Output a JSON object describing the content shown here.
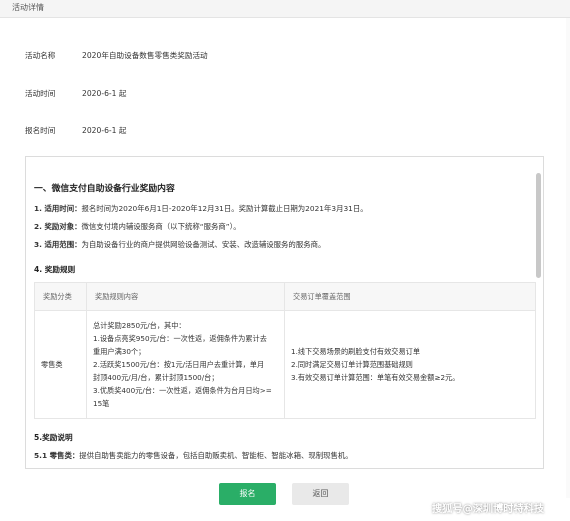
{
  "header": {
    "title": "活动详情"
  },
  "info": [
    {
      "label": "活动名称",
      "value": "2020年自助设备数售零售类奖励活动"
    },
    {
      "label": "活动时间",
      "value": "2020-6-1 起"
    },
    {
      "label": "报名时间",
      "value": "2020-6-1 起"
    }
  ],
  "panel": {
    "section_title": "一、微信支付自助设备行业奖励内容",
    "items": [
      {
        "key": "1. 适用时间：",
        "text": "报名时间为2020年6月1日-2020年12月31日。奖励计算截止日期为2021年3月31日。"
      },
      {
        "key": "2. 奖励对象：",
        "text": "微信支付境内辅设服务商（以下统称“服务商”）。"
      },
      {
        "key": "3. 适用范围：",
        "text": "为自助设备行业的商户提供网验设备测试、安装、改造辅设服务的服务商。"
      }
    ],
    "rules_title": "4. 奖励规则",
    "table": {
      "headers": [
        "奖励分类",
        "奖励规则内容",
        "交易订单覆盖范围"
      ],
      "category": "零售类",
      "content_lines": [
        "总计奖励2850元/台，其中：",
        "1.设备点亮奖950元/台：一次性返，返佣条件为累计去",
        "重用户满30个；",
        "2.活跃奖1500元/台：按1元/活日用户去重计算，单月",
        "封顶400元/月/台，累计封顶1500/台；",
        "3.优质奖400元/台：一次性返，返佣条件为台月日均>=",
        "15笔"
      ],
      "scope_lines": [
        "1.线下交易场景的刷脸支付有效交易订单",
        "2.同时满足交易订单计算范围基础规则",
        "3.有效交易订单计算范围：单笔有效交易金额≥2元。"
      ]
    },
    "notes_title": "5.奖励说明",
    "note_item": {
      "key": "5.1 零售类：",
      "text": "提供自助售卖能力的零售设备，包括自助贩卖机、智能柜、智能冰箱、现制现售机。"
    }
  },
  "buttons": {
    "submit": "报名",
    "back": "返回"
  },
  "watermark": "搜狐号@深圳博时特科技"
}
